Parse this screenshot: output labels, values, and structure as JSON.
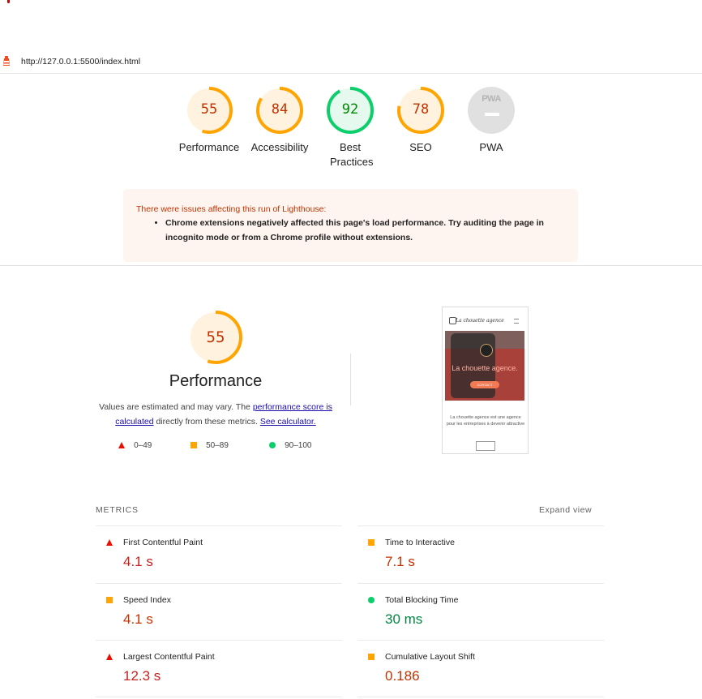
{
  "url": "http://127.0.0.1:5500/index.html",
  "gauges": [
    {
      "score": "55",
      "label": "Performance",
      "fraction": 0.55,
      "color": "#ffa400"
    },
    {
      "score": "84",
      "label": "Accessibility",
      "fraction": 0.84,
      "color": "#ffa400"
    },
    {
      "score": "92",
      "label": "Best Practices",
      "fraction": 0.92,
      "color": "#0cce6b"
    },
    {
      "score": "78",
      "label": "SEO",
      "fraction": 0.78,
      "color": "#ffa400"
    },
    {
      "score": "PWA",
      "label": "PWA",
      "fraction": 0,
      "color": "#e0e0e0"
    }
  ],
  "warning": {
    "title": "There were issues affecting this run of Lighthouse:",
    "item": "Chrome extensions negatively affected this page's load performance. Try auditing the page in incognito mode or from a Chrome profile without extensions."
  },
  "performance": {
    "score": "55",
    "fraction": 0.55,
    "title": "Performance",
    "desc_prefix": "Values are estimated and may vary. The ",
    "link1": "performance score is calculated",
    "desc_middle": " directly from these metrics. ",
    "link2": "See calculator."
  },
  "scale": {
    "fail": "0–49",
    "average": "50–89",
    "pass": "90–100"
  },
  "thumbnail": {
    "logo": "La chouette agence",
    "hero_text": "La chouette agence.",
    "button": "CONTACT",
    "body": "La chouette agence est une agence pour les entreprises à devenir attractive"
  },
  "metrics": {
    "header": "METRICS",
    "expand": "Expand view",
    "items": [
      {
        "label": "First Contentful Paint",
        "value": "4.1 s",
        "status": "fail"
      },
      {
        "label": "Time to Interactive",
        "value": "7.1 s",
        "status": "average"
      },
      {
        "label": "Speed Index",
        "value": "4.1 s",
        "status": "average"
      },
      {
        "label": "Total Blocking Time",
        "value": "30 ms",
        "status": "pass"
      },
      {
        "label": "Largest Contentful Paint",
        "value": "12.3 s",
        "status": "fail"
      },
      {
        "label": "Cumulative Layout Shift",
        "value": "0.186",
        "status": "average"
      }
    ]
  }
}
